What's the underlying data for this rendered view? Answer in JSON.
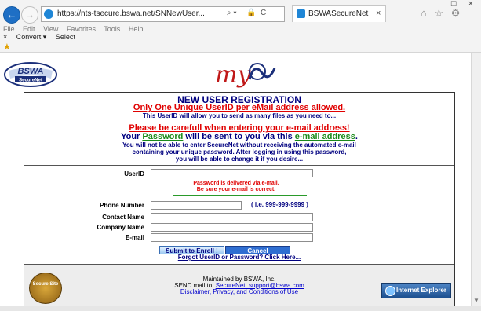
{
  "browser": {
    "back_symbol": "←",
    "forward_symbol": "→",
    "url": "https://nts-tsecure.bswa.net/SNNewUser...",
    "addr_tools": [
      "⌕ ▾",
      "🔒",
      "C"
    ],
    "tab_title": "BSWASecureNet",
    "tab_close": "×",
    "window_controls": "□ ×",
    "toolbar_icons": "⌂ ☆ ⚙",
    "menu": [
      "File",
      "Edit",
      "View",
      "Favorites",
      "Tools",
      "Help"
    ],
    "bar2_close": "×",
    "bar2_items": [
      "Convert ▾",
      "Select"
    ],
    "fav_icon": "star-icon"
  },
  "logos": {
    "bswa": "BSWA",
    "bswa_sub": "SecureNet",
    "my": "my"
  },
  "registration": {
    "title": "NEW USER REGISTRATION",
    "one_id": "Only One Unique UserID per eMail address allowed.",
    "allow": "This UserID will allow you to send as many files as you need to...",
    "careful": "Please be carefull when entering your e-mail address!",
    "pw_line_1": "Your ",
    "pw_word": "Password",
    "pw_line_2": " will be sent to you via this ",
    "email_word": "e-mail address",
    "pw_line_3": ".",
    "note1": "You will not be able to enter SecureNet without receiving the automated e-mail",
    "note2": "containing your unique password.  After logging in using this password,",
    "note3": "you will be able to change it if you desire..."
  },
  "form": {
    "userid_label": "UserID",
    "pw_note1": "Password is delivered via e-mail.",
    "pw_note2": "Be sure your e-mail is correct.",
    "phone_label": "Phone Number",
    "phone_hint": "( i.e. 999-999-9999 )",
    "contact_label": "Contact Name",
    "company_label": "Company Name",
    "email_label": "E-mail",
    "submit": "Submit to Enroll !",
    "cancel": "Cancel",
    "forgot": "Forgot UserID or Password? Click Here..."
  },
  "footer": {
    "badge": "Secure Site",
    "maintained": "Maintained by BSWA, Inc.",
    "send_prefix": "SEND mail to: ",
    "send_email": "SecureNet_support@bswa.com",
    "disclaimer": "Disclaimer, Privacy, and Conditions of Use",
    "ie_text": "Internet Explorer"
  }
}
